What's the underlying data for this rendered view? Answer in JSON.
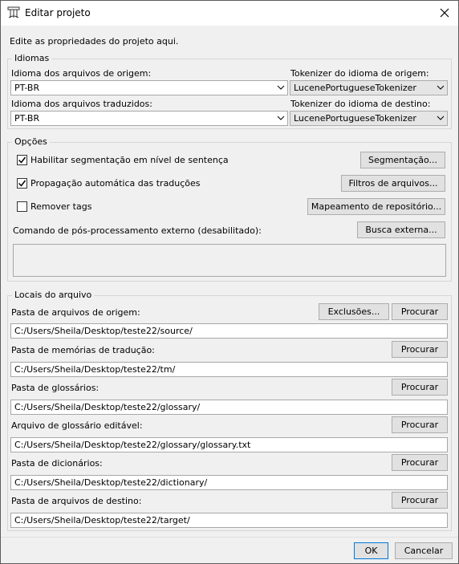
{
  "window": {
    "title": "Editar projeto",
    "app_icon": "omegat-icon",
    "close_icon": "close-icon"
  },
  "intro": "Edite as propriedades do projeto aqui.",
  "languages": {
    "legend": "Idiomas",
    "source_label": "Idioma dos arquivos de origem:",
    "source_value": "PT-BR",
    "source_tokenizer_label": "Tokenizer do idioma de origem:",
    "source_tokenizer_value": "LucenePortugueseTokenizer",
    "target_label": "Idioma dos arquivos traduzidos:",
    "target_value": "PT-BR",
    "target_tokenizer_label": "Tokenizer do idioma de destino:",
    "target_tokenizer_value": "LucenePortugueseTokenizer"
  },
  "options": {
    "legend": "Opções",
    "sentence_seg": {
      "label": "Habilitar segmentação em nível de sentença",
      "checked": true
    },
    "auto_propagation": {
      "label": "Propagação automática das traduções",
      "checked": true
    },
    "remove_tags": {
      "label": "Remover tags",
      "checked": false
    },
    "segmentation_button": "Segmentação...",
    "file_filters_button": "Filtros de arquivos...",
    "repo_mapping_button": "Mapeamento de repositório...",
    "external_command_label": "Comando de pós-processamento externo (desabilitado):",
    "external_search_button": "Busca externa...",
    "external_command_value": ""
  },
  "locations": {
    "legend": "Locais do arquivo",
    "exclusions_button": "Exclusões...",
    "browse_label": "Procurar",
    "source": {
      "label": "Pasta de arquivos de origem:",
      "value": "C:/Users/Sheila/Desktop/teste22/source/"
    },
    "tm": {
      "label": "Pasta de memórias de tradução:",
      "value": "C:/Users/Sheila/Desktop/teste22/tm/"
    },
    "glossary": {
      "label": "Pasta de glossários:",
      "value": "C:/Users/Sheila/Desktop/teste22/glossary/"
    },
    "writable_glossary": {
      "label": "Arquivo de glossário editável:",
      "value": "C:/Users/Sheila/Desktop/teste22/glossary/glossary.txt"
    },
    "dictionary": {
      "label": "Pasta de dicionários:",
      "value": "C:/Users/Sheila/Desktop/teste22/dictionary/"
    },
    "target": {
      "label": "Pasta de arquivos de destino:",
      "value": "C:/Users/Sheila/Desktop/teste22/target/"
    }
  },
  "footer": {
    "ok": "OK",
    "cancel": "Cancelar"
  }
}
